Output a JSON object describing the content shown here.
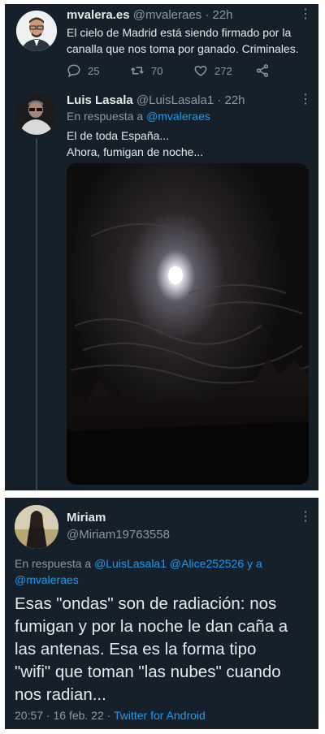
{
  "tweet1": {
    "name": "mvalera.es",
    "handle_time": "@mvaleraes · 22h",
    "text_line1": "El cielo de Madrid está siendo firmado por la",
    "text_line2": "canalla que nos toma por ganado. Criminales.",
    "replies": "25",
    "retweets": "70",
    "likes": "272"
  },
  "tweet2": {
    "name": "Luis Lasala",
    "handle_time": "@LuisLasala1 · 22h",
    "reply_prefix": "En respuesta a",
    "reply_to": "@mvaleraes",
    "text_line1": "El de toda España...",
    "text_line2": "Ahora, fumigan de noche..."
  },
  "tweet3": {
    "name": "Miriam",
    "handle": "@Miriam19763558",
    "reply_prefix": "En respuesta a",
    "reply_to_1": "@LuisLasala1",
    "reply_to_2": "@Alice252526",
    "reply_and": "y a",
    "reply_to_3": "@mvaleraes",
    "text_line1": "Esas \"ondas\" son de radiación: nos",
    "text_line2": "fumigan y por la noche le dan caña a",
    "text_line3": "las antenas. Esa es la forma tipo",
    "text_line4": "\"wifi\" que toman \"las nubes\" cuando",
    "text_line5": "nos radian...",
    "timestamp": "20:57 · 16 feb. 22",
    "separator": "·",
    "source": "Twitter for Android"
  },
  "icons": [
    "more-icon",
    "reply-icon",
    "retweet-icon",
    "like-icon",
    "share-icon"
  ],
  "colors": {
    "background": "#15202b",
    "link": "#1d9bf0",
    "muted": "#8b98a5",
    "text": "#e7e9ea"
  }
}
